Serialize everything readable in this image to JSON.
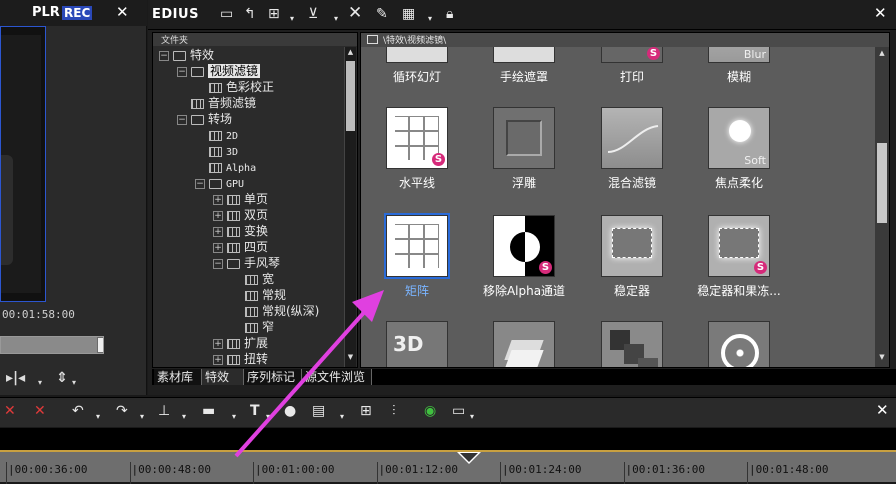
{
  "player": {
    "plr_label": "PLR",
    "rec_label": "REC",
    "close_glyph": "✕",
    "timecode": "00:01:58:00",
    "progress": 0.92,
    "tools": [
      "▸|◂",
      "⇕"
    ]
  },
  "bin": {
    "app_title": "EDIUS",
    "close_glyph": "✕",
    "tree": {
      "header": "文件夹",
      "nodes": [
        {
          "label": "特效",
          "exp": "−",
          "icon": "folder",
          "indent": 0
        },
        {
          "label": "视频滤镜",
          "exp": "−",
          "icon": "folder",
          "indent": 1,
          "selected": true
        },
        {
          "label": "色彩校正",
          "exp": "",
          "icon": "grid",
          "indent": 2
        },
        {
          "label": "音频滤镜",
          "exp": "",
          "icon": "grid",
          "indent": 1
        },
        {
          "label": "转场",
          "exp": "−",
          "icon": "folder",
          "indent": 1
        },
        {
          "label": "2D",
          "exp": "",
          "icon": "grid",
          "indent": 2
        },
        {
          "label": "3D",
          "exp": "",
          "icon": "grid",
          "indent": 2
        },
        {
          "label": "Alpha",
          "exp": "",
          "icon": "grid",
          "indent": 2
        },
        {
          "label": "GPU",
          "exp": "−",
          "icon": "folder",
          "indent": 2
        },
        {
          "label": "单页",
          "exp": "+",
          "icon": "grid",
          "indent": 3
        },
        {
          "label": "双页",
          "exp": "+",
          "icon": "grid",
          "indent": 3
        },
        {
          "label": "变换",
          "exp": "+",
          "icon": "grid",
          "indent": 3
        },
        {
          "label": "四页",
          "exp": "+",
          "icon": "grid",
          "indent": 3
        },
        {
          "label": "手风琴",
          "exp": "−",
          "icon": "folder",
          "indent": 3
        },
        {
          "label": "宽",
          "exp": "",
          "icon": "grid",
          "indent": 4
        },
        {
          "label": "常规",
          "exp": "",
          "icon": "grid",
          "indent": 4
        },
        {
          "label": "常规(纵深)",
          "exp": "",
          "icon": "grid",
          "indent": 4
        },
        {
          "label": "窄",
          "exp": "",
          "icon": "grid",
          "indent": 4
        },
        {
          "label": "扩展",
          "exp": "+",
          "icon": "grid",
          "indent": 3
        },
        {
          "label": "扭转",
          "exp": "+",
          "icon": "grid",
          "indent": 3
        }
      ]
    },
    "tabs": [
      "素材库",
      "特效",
      "序列标记",
      "源文件浏览"
    ],
    "active_tab": 1,
    "grid_path": "\\特效\\视频滤镜\\",
    "effects": [
      {
        "label": "循环幻灯",
        "thumb": "partial-white",
        "badge": false
      },
      {
        "label": "手绘遮罩",
        "thumb": "partial-white",
        "badge": false
      },
      {
        "label": "打印",
        "thumb": "partial-dark",
        "badge": true
      },
      {
        "label": "模糊",
        "thumb": "blur",
        "badge": false,
        "caption": "Blur"
      },
      {
        "label": "水平线",
        "thumb": "grid",
        "badge": true
      },
      {
        "label": "浮雕",
        "thumb": "emboss",
        "badge": false
      },
      {
        "label": "混合滤镜",
        "thumb": "curve",
        "badge": false
      },
      {
        "label": "焦点柔化",
        "thumb": "soft",
        "badge": false,
        "caption": "Soft"
      },
      {
        "label": "矩阵",
        "thumb": "grid",
        "badge": false,
        "selected": true
      },
      {
        "label": "移除Alpha通道",
        "thumb": "alpha",
        "badge": true
      },
      {
        "label": "稳定器",
        "thumb": "stabilizer",
        "badge": false
      },
      {
        "label": "稳定器和果冻...",
        "thumb": "stabilizer",
        "badge": true
      },
      {
        "label": "",
        "thumb": "3d",
        "badge": false,
        "caption": "3D"
      },
      {
        "label": "",
        "thumb": "layers",
        "badge": false
      },
      {
        "label": "",
        "thumb": "squares",
        "badge": false
      },
      {
        "label": "",
        "thumb": "reel",
        "badge": false
      }
    ]
  },
  "timeline": {
    "close_glyph": "✕",
    "ruler": [
      "00:00:36:00",
      "00:00:48:00",
      "00:01:00:00",
      "00:01:12:00",
      "00:01:24:00",
      "00:01:36:00",
      "00:01:48:00"
    ]
  },
  "colors": {
    "accent_rec": "#2a48b8",
    "selection": "#2a6bd8",
    "badge": "#d62a7a",
    "arrow": "#e040e0"
  }
}
